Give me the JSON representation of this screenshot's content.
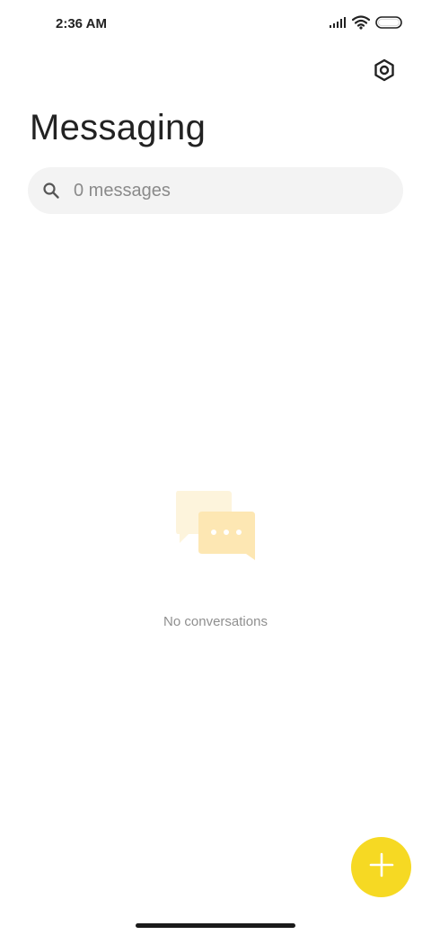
{
  "status_bar": {
    "time": "2:36 AM",
    "icons": [
      "signal-icon",
      "wifi-icon",
      "battery-icon"
    ]
  },
  "header": {
    "settings_icon": "settings-hexagon-icon",
    "title": "Messaging"
  },
  "search": {
    "icon": "search-icon",
    "placeholder": "0 messages"
  },
  "empty_state": {
    "illustration": "chat-bubbles-icon",
    "message": "No conversations"
  },
  "fab": {
    "icon": "plus-icon",
    "color": "#f6d923"
  },
  "colors": {
    "accent": "#f6d923",
    "illustration_light": "#fdf4dc",
    "illustration_mid": "#fde7b3"
  }
}
